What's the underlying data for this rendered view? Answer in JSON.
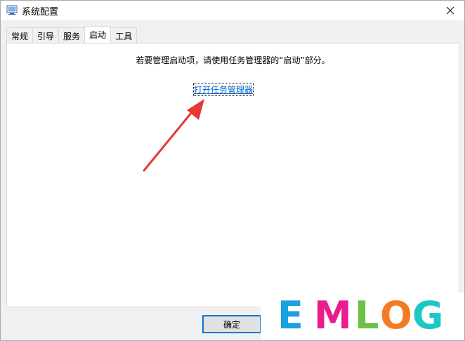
{
  "window": {
    "title": "系统配置"
  },
  "tabs": [
    {
      "label": "常规"
    },
    {
      "label": "引导"
    },
    {
      "label": "服务"
    },
    {
      "label": "启动",
      "active": true
    },
    {
      "label": "工具"
    }
  ],
  "startup": {
    "info": "若要管理启动项，请使用任务管理器的“启动”部分。",
    "link": "打开任务管理器"
  },
  "buttons": {
    "ok": "确定"
  },
  "watermark": {
    "letters": [
      {
        "char": "E",
        "color": "#1ba1e2"
      },
      {
        "char": "M",
        "color": "#e91e8c"
      },
      {
        "char": "L",
        "color": "#6cc04a"
      },
      {
        "char": "O",
        "color": "#f47b20"
      },
      {
        "char": "G",
        "color": "#1bc7c7"
      }
    ]
  },
  "colors": {
    "link": "#0066cc",
    "arrow": "#e53935",
    "accent": "#0078d7"
  }
}
